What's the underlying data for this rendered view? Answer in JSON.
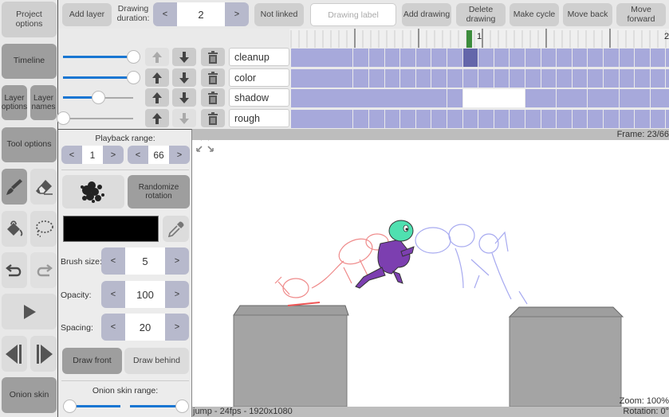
{
  "left_toolbar": {
    "project_options": "Project options",
    "timeline": "Timeline",
    "layer_options": "Layer options",
    "layer_names": "Layer names",
    "tool_options": "Tool options",
    "onion_skin": "Onion skin",
    "tools": [
      {
        "name": "brush",
        "icon": "brush-icon",
        "active": true
      },
      {
        "name": "eraser",
        "icon": "eraser-icon",
        "active": false
      },
      {
        "name": "fill",
        "icon": "paint-bucket-icon",
        "active": false
      },
      {
        "name": "lasso",
        "icon": "lasso-icon",
        "active": false
      },
      {
        "name": "undo",
        "icon": "undo-icon",
        "enabled": true
      },
      {
        "name": "redo",
        "icon": "redo-icon",
        "enabled": false
      },
      {
        "name": "play",
        "icon": "play-icon"
      },
      {
        "name": "previous-frame",
        "icon": "step-back-icon"
      },
      {
        "name": "next-frame",
        "icon": "step-forward-icon"
      }
    ]
  },
  "top_bar": {
    "add_layer": "Add layer",
    "drawing_duration_label": "Drawing duration:",
    "drawing_duration_value": "2",
    "decrement": "<",
    "increment": ">",
    "not_linked": "Not linked",
    "drawing_label_placeholder": "Drawing label",
    "add_drawing": "Add drawing",
    "delete_drawing": "Delete drawing",
    "make_cycle": "Make cycle",
    "move_back": "Move back",
    "move_forward": "Move forward"
  },
  "layers": [
    {
      "name": "cleanup",
      "opacity": 1.0,
      "can_move_up": false,
      "can_move_down": true
    },
    {
      "name": "color",
      "opacity": 1.0,
      "can_move_up": true,
      "can_move_down": true
    },
    {
      "name": "shadow",
      "opacity": 0.5,
      "can_move_up": true,
      "can_move_down": true
    },
    {
      "name": "rough",
      "opacity": 0.0,
      "can_move_up": true,
      "can_move_down": false
    }
  ],
  "timeline": {
    "ruler_labels": [
      "1",
      "2"
    ],
    "current_frame": 23,
    "total_frames": 66,
    "colors": {
      "cell": "#a7a9db",
      "selected_cell": "#6466aa",
      "playhead": "#3c8c3c"
    }
  },
  "tool_options": {
    "playback_range_label": "Playback range:",
    "playback_start": "1",
    "playback_end": "66",
    "randomize_rotation": "Randomize rotation",
    "brush_color": "#000000",
    "brush_size_label": "Brush size:",
    "brush_size": "5",
    "opacity_label": "Opacity:",
    "opacity": "100",
    "spacing_label": "Spacing:",
    "spacing": "20",
    "draw_front": "Draw front",
    "draw_behind": "Draw behind",
    "onion_skin_range_label": "Onion skin range:",
    "onion_before": 0,
    "onion_after": 1
  },
  "canvas": {
    "frame_readout": "Frame: 23/66",
    "zoom_readout": "Zoom: 100%",
    "rotation_readout": "Rotation: 0°",
    "project_info": "jump - 24fps - 1920x1080"
  }
}
